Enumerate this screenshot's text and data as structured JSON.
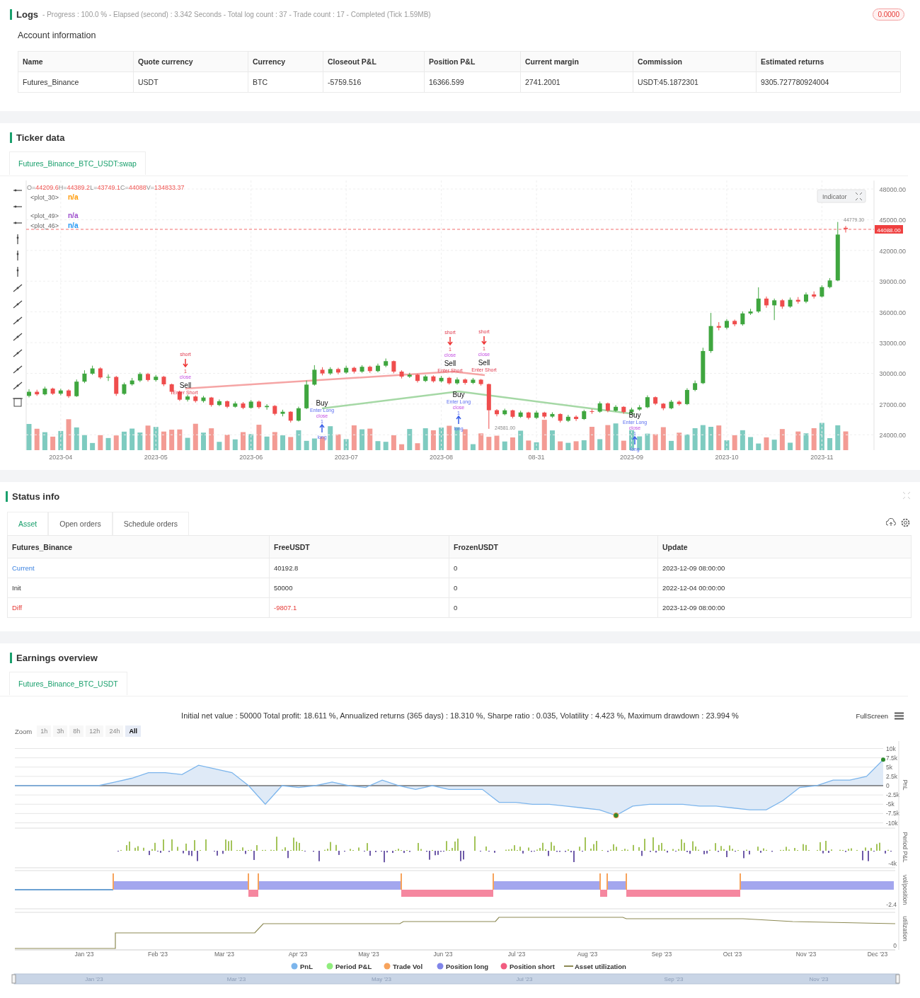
{
  "logs": {
    "title": "Logs",
    "summary": "- Progress : 100.0 % - Elapsed (second) : 3.342  Seconds - Total log count : 37 - Trade count : 17 - Completed (Tick 1.59MB)",
    "badge": "0.0000"
  },
  "account": {
    "title": "Account information",
    "columns": [
      "Name",
      "Quote currency",
      "Currency",
      "Closeout P&L",
      "Position P&L",
      "Current margin",
      "Commission",
      "Estimated returns"
    ],
    "rows": [
      [
        "Futures_Binance",
        "USDT",
        "BTC",
        "-5759.516",
        "16366.599",
        "2741.2001",
        "USDT:45.1872301",
        "9305.727780924004"
      ]
    ]
  },
  "ticker": {
    "title": "Ticker data",
    "tabs": [
      {
        "label": "Futures_Binance_BTC_USDT:swap",
        "selected": true
      }
    ],
    "ohlc": [
      {
        "key": "O=",
        "value": "44209.6"
      },
      {
        "key": "H=",
        "value": "44389.2"
      },
      {
        "key": "L=",
        "value": "43749.1"
      },
      {
        "key": "C=",
        "value": "44088"
      },
      {
        "key": "V=",
        "value": "134833.37"
      }
    ],
    "legend": [
      {
        "name": "<plot_30>",
        "value": "n/a",
        "color": "#ff9800"
      },
      {
        "name": "<plot_49>",
        "value": "n/a",
        "color": "#9c4dcc"
      },
      {
        "name": "<plot_46>",
        "value": "n/a",
        "color": "#2196f3"
      }
    ],
    "indicator_button": "Indicator",
    "last_price": "44088.00",
    "high_label": "44779.30",
    "low_label": "24581.00",
    "chart_data": {
      "type": "candlestick",
      "ylim": [
        22500,
        48830
      ],
      "grid": true,
      "categories": [
        null,
        null,
        null,
        null,
        "2023-04",
        null,
        null,
        null,
        null,
        null,
        null,
        null,
        null,
        null,
        null,
        null,
        "2023-05",
        null,
        null,
        null,
        null,
        null,
        null,
        null,
        null,
        null,
        null,
        null,
        "2023-06",
        null,
        null,
        null,
        null,
        null,
        null,
        null,
        null,
        null,
        null,
        null,
        "2023-07",
        null,
        null,
        null,
        null,
        null,
        null,
        null,
        null,
        null,
        null,
        null,
        "2023-08",
        null,
        null,
        null,
        null,
        null,
        null,
        null,
        null,
        null,
        null,
        null,
        "08-31",
        null,
        null,
        null,
        null,
        null,
        null,
        null,
        null,
        null,
        null,
        null,
        "2023-09",
        null,
        null,
        null,
        null,
        null,
        null,
        null,
        null,
        null,
        null,
        null,
        "2023-10",
        null,
        null,
        null,
        null,
        null,
        null,
        null,
        null,
        null,
        null,
        null,
        "2023-11",
        null,
        null,
        null
      ],
      "ohlc": [
        [
          27800,
          28450,
          27650,
          28200
        ],
        [
          28200,
          28400,
          27800,
          27950
        ],
        [
          27950,
          28700,
          27850,
          28510
        ],
        [
          28510,
          28600,
          27900,
          28015
        ],
        [
          28015,
          28500,
          27850,
          28330
        ],
        [
          28330,
          28450,
          27600,
          27770
        ],
        [
          27770,
          29400,
          27700,
          29190
        ],
        [
          29190,
          30300,
          29050,
          29970
        ],
        [
          29970,
          30750,
          29850,
          30480
        ],
        [
          30480,
          30600,
          29450,
          29600
        ],
        [
          29600,
          29900,
          29250,
          29650
        ],
        [
          29650,
          29750,
          27800,
          28000
        ],
        [
          28000,
          29100,
          27900,
          28930
        ],
        [
          28930,
          29550,
          28800,
          29300
        ],
        [
          29300,
          30100,
          29150,
          29940
        ],
        [
          29940,
          30050,
          29200,
          29350
        ],
        [
          29350,
          29850,
          29200,
          29670
        ],
        [
          29670,
          29750,
          28750,
          28930
        ],
        [
          28930,
          29000,
          27950,
          28200
        ],
        [
          28200,
          28300,
          27300,
          27430
        ],
        [
          27430,
          27900,
          27250,
          27740
        ],
        [
          27740,
          27850,
          27150,
          27300
        ],
        [
          27300,
          27800,
          27150,
          27640
        ],
        [
          27640,
          27700,
          26750,
          26910
        ],
        [
          26910,
          27450,
          26800,
          27280
        ],
        [
          27280,
          27350,
          26600,
          26740
        ],
        [
          26740,
          27250,
          26650,
          27060
        ],
        [
          27060,
          27200,
          26500,
          26630
        ],
        [
          26630,
          27400,
          26550,
          27240
        ],
        [
          27240,
          27350,
          26550,
          26700
        ],
        [
          26700,
          27000,
          26450,
          26820
        ],
        [
          26820,
          26900,
          25900,
          26050
        ],
        [
          26050,
          26450,
          25800,
          26250
        ],
        [
          26250,
          26300,
          25200,
          25380
        ],
        [
          25380,
          26750,
          25300,
          26590
        ],
        [
          26590,
          29300,
          26500,
          28900
        ],
        [
          28900,
          30800,
          28800,
          30350
        ],
        [
          30350,
          30600,
          29800,
          29990
        ],
        [
          29990,
          30600,
          29850,
          30420
        ],
        [
          30420,
          30550,
          29900,
          30080
        ],
        [
          30080,
          30750,
          29950,
          30540
        ],
        [
          30540,
          30650,
          30000,
          30170
        ],
        [
          30170,
          30800,
          30050,
          30640
        ],
        [
          30640,
          30750,
          30050,
          30220
        ],
        [
          30220,
          30950,
          30100,
          30750
        ],
        [
          30750,
          31450,
          30600,
          31190
        ],
        [
          31190,
          31250,
          30000,
          30170
        ],
        [
          30170,
          30300,
          29500,
          29680
        ],
        [
          29680,
          30050,
          29550,
          29870
        ],
        [
          29870,
          29950,
          29100,
          29260
        ],
        [
          29260,
          29850,
          29150,
          29700
        ],
        [
          29700,
          29800,
          29100,
          29230
        ],
        [
          29230,
          29750,
          29100,
          29560
        ],
        [
          29560,
          29650,
          28900,
          29030
        ],
        [
          29030,
          29600,
          28900,
          29400
        ],
        [
          29400,
          29500,
          28900,
          29070
        ],
        [
          29070,
          29550,
          28950,
          29380
        ],
        [
          29380,
          29450,
          28800,
          28950
        ],
        [
          28950,
          29000,
          24581,
          26400
        ],
        [
          26400,
          26500,
          25800,
          26010
        ],
        [
          26010,
          26550,
          25900,
          26390
        ],
        [
          26390,
          26450,
          25600,
          25760
        ],
        [
          25760,
          26350,
          25650,
          26180
        ],
        [
          26180,
          26250,
          25500,
          25660
        ],
        [
          25660,
          26350,
          25550,
          26170
        ],
        [
          26170,
          26250,
          25600,
          25780
        ],
        [
          25780,
          26200,
          25650,
          26030
        ],
        [
          26030,
          26100,
          25200,
          25370
        ],
        [
          25370,
          25950,
          25250,
          25760
        ],
        [
          25760,
          25900,
          25350,
          25540
        ],
        [
          25540,
          26450,
          25450,
          26300
        ],
        [
          26300,
          26500,
          26050,
          26260
        ],
        [
          26260,
          27250,
          26150,
          27070
        ],
        [
          27070,
          27150,
          26200,
          26350
        ],
        [
          26350,
          26900,
          26250,
          26730
        ],
        [
          26730,
          26800,
          26050,
          26220
        ],
        [
          26220,
          26650,
          26100,
          26470
        ],
        [
          26470,
          26900,
          26350,
          26690
        ],
        [
          26690,
          27850,
          26600,
          27670
        ],
        [
          27670,
          27750,
          26900,
          27040
        ],
        [
          27040,
          27100,
          26400,
          26590
        ],
        [
          26590,
          27400,
          26500,
          27230
        ],
        [
          27230,
          27350,
          26850,
          27000
        ],
        [
          27000,
          28550,
          26900,
          28380
        ],
        [
          28380,
          29300,
          28250,
          29040
        ],
        [
          29040,
          32500,
          28950,
          32180
        ],
        [
          32180,
          35900,
          32000,
          34620
        ],
        [
          34620,
          35000,
          34200,
          34460
        ],
        [
          34460,
          35300,
          34300,
          35120
        ],
        [
          35120,
          35250,
          34600,
          34790
        ],
        [
          34790,
          36050,
          34650,
          35850
        ],
        [
          35850,
          36300,
          35700,
          36040
        ],
        [
          36040,
          38400,
          35900,
          37300
        ],
        [
          37300,
          37500,
          36400,
          36640
        ],
        [
          36640,
          37300,
          35200,
          37130
        ],
        [
          37130,
          37250,
          36300,
          36520
        ],
        [
          36520,
          37400,
          36400,
          37180
        ],
        [
          37180,
          37450,
          36800,
          37000
        ],
        [
          37000,
          37900,
          36850,
          37700
        ],
        [
          37700,
          38000,
          37300,
          37500
        ],
        [
          37500,
          38600,
          37400,
          38420
        ],
        [
          38420,
          39300,
          38300,
          39070
        ],
        [
          39070,
          44779.3,
          39000,
          43550
        ],
        [
          44209.6,
          44389.2,
          43749.1,
          44088
        ]
      ],
      "yticks": [
        {
          "value": 48000,
          "label": "48000.00"
        },
        {
          "value": 45000,
          "label": "45000.00"
        },
        {
          "value": 42000,
          "label": "42000.00"
        },
        {
          "value": 39000,
          "label": "39000.00"
        },
        {
          "value": 36000,
          "label": "36000.00"
        },
        {
          "value": 33000,
          "label": "33000.00"
        },
        {
          "value": 30000,
          "label": "30000.00"
        },
        {
          "value": 27000,
          "label": "27000.00"
        },
        {
          "value": 24000,
          "label": "24000.00"
        }
      ]
    },
    "signals": [
      {
        "kind": "sell",
        "tag": "short",
        "count": "1",
        "note": "close",
        "entry": "Enter Short",
        "action": "Sell"
      },
      {
        "kind": "buy",
        "tag": "long",
        "count": "1",
        "note": "close",
        "entry": "Enter Long",
        "action": "Buy"
      },
      {
        "kind": "sell",
        "tag": "short",
        "count": "1",
        "note": "close",
        "entry": "Enter Short",
        "action": "Sell"
      },
      {
        "kind": "buy",
        "tag": "long",
        "count": "1",
        "note": "close",
        "entry": "Enter Long",
        "action": "Buy"
      },
      {
        "kind": "sell",
        "tag": "short",
        "count": "1",
        "note": "close",
        "entry": "Enter Short",
        "action": "Sell"
      },
      {
        "kind": "buy",
        "tag": "long",
        "count": "1",
        "note": "close",
        "entry": "Enter Long",
        "action": "Buy"
      }
    ]
  },
  "status": {
    "title": "Status info",
    "tabs": [
      {
        "label": "Asset",
        "selected": true
      },
      {
        "label": "Open orders",
        "selected": false
      },
      {
        "label": "Schedule orders",
        "selected": false
      }
    ],
    "columns": [
      "Futures_Binance",
      "FreeUSDT",
      "FrozenUSDT",
      "Update"
    ],
    "rows": [
      {
        "kind": "current",
        "cells": [
          "Current",
          "40192.8",
          "0",
          "2023-12-09 08:00:00"
        ]
      },
      {
        "kind": "init",
        "cells": [
          "Init",
          "50000",
          "0",
          "2022-12-04 00:00:00"
        ]
      },
      {
        "kind": "diff",
        "cells": [
          "Diff",
          "-9807.1",
          "0",
          "2023-12-09 08:00:00"
        ]
      }
    ]
  },
  "earnings": {
    "title": "Earnings overview",
    "tabs": [
      {
        "label": "Futures_Binance_BTC_USDT",
        "selected": true
      }
    ],
    "summary": "Initial net value : 50000 Total profit: 18.611 %, Annualized returns (365 days) : 18.310 %, Sharpe ratio : 0.035, Volatility : 4.423 %, Maximum drawdown : 23.994 %",
    "fullscreen": "FullScreen",
    "zoom_label": "Zoom",
    "zoom": [
      {
        "label": "1h",
        "selected": false,
        "disabled": true
      },
      {
        "label": "3h",
        "selected": false,
        "disabled": true
      },
      {
        "label": "8h",
        "selected": false,
        "disabled": true
      },
      {
        "label": "12h",
        "selected": false,
        "disabled": true
      },
      {
        "label": "24h",
        "selected": false,
        "disabled": true
      },
      {
        "label": "All",
        "selected": true,
        "disabled": false
      }
    ],
    "chart_data": {
      "type": "area",
      "ylabel": "PnL",
      "ylim": [
        -10000,
        10000
      ],
      "grid": true,
      "categories": [
        null,
        null,
        null,
        null,
        null,
        null,
        null,
        null,
        null,
        null,
        null,
        null,
        null,
        null,
        null,
        null,
        null,
        null,
        null,
        null,
        null,
        null,
        null,
        null,
        null,
        null,
        null,
        null,
        null,
        null,
        null,
        null,
        null,
        null,
        null,
        null,
        null,
        null,
        null,
        null,
        null,
        null,
        null,
        null,
        null,
        null,
        null,
        null,
        null,
        null,
        null,
        null,
        null
      ],
      "series": [
        {
          "name": "PnL",
          "color": "#7cb5ec",
          "values": [
            0,
            0,
            0,
            0,
            0,
            0,
            1000,
            2000,
            3500,
            3500,
            3000,
            5500,
            4500,
            3500,
            0,
            -5000,
            0,
            -500,
            0,
            1000,
            0,
            -500,
            1500,
            0,
            -1000,
            0,
            -1000,
            -1000,
            -1000,
            -4500,
            -4500,
            -5000,
            -5000,
            -5500,
            -6000,
            -6500,
            -8000,
            -5500,
            -5000,
            -5000,
            -5000,
            -5500,
            -5500,
            -6000,
            -6500,
            -6500,
            -4000,
            -500,
            0,
            1500,
            1500,
            2500,
            7000
          ]
        }
      ],
      "yticks": [
        {
          "value": 10000,
          "label": "10k"
        },
        {
          "value": 7500,
          "label": "7.5k"
        },
        {
          "value": 5000,
          "label": "5k"
        },
        {
          "value": 2500,
          "label": "2.5k"
        },
        {
          "value": 0,
          "label": "0"
        },
        {
          "value": -2500,
          "label": "-2.5k"
        },
        {
          "value": -5000,
          "label": "-5k"
        },
        {
          "value": -7500,
          "label": "-7.5k"
        },
        {
          "value": -10000,
          "label": "-10k"
        }
      ]
    },
    "xlabels": [
      "Jan '23",
      "Feb '23",
      "Mar '23",
      "Apr '23",
      "May '23",
      "Jun '23",
      "Jul '23",
      "Aug '23",
      "Sep '23",
      "Oct '23",
      "Nov '23",
      "Dec '23"
    ],
    "panels": [
      {
        "title": "Period P&L",
        "ticks": [
          "-4k"
        ]
      },
      {
        "title": "vol/position",
        "ticks": [
          "-2.4"
        ]
      },
      {
        "title": "utilization",
        "ticks": [
          "0"
        ]
      }
    ],
    "legend": [
      {
        "label": "Period P&L",
        "color": "#90ed7d",
        "kind": "dot"
      },
      {
        "label": "Trade Vol",
        "color": "#f7a35c",
        "kind": "dot"
      },
      {
        "label": "Position long",
        "color": "#8085e9",
        "kind": "dot"
      },
      {
        "label": "Position short",
        "color": "#f15c80",
        "kind": "dot"
      },
      {
        "label": "Asset utilization",
        "color": "#8d8a54",
        "kind": "line"
      }
    ],
    "navigator": [
      "Jan '23",
      "Mar '23",
      "May '23",
      "Jul '23",
      "Sep '23",
      "Nov '23"
    ]
  }
}
